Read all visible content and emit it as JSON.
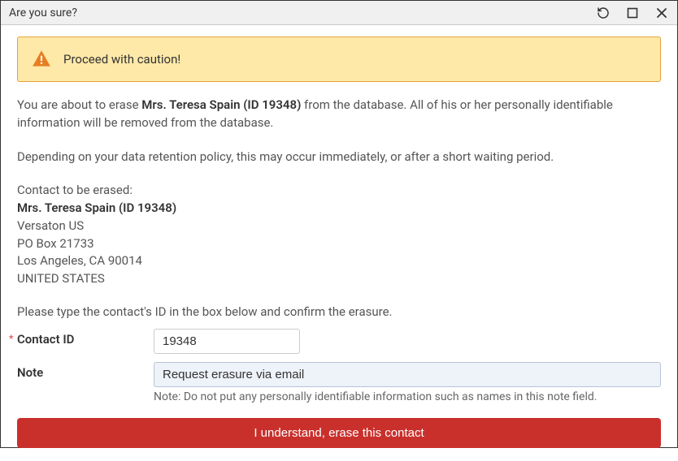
{
  "window": {
    "title": "Are you sure?"
  },
  "alert": {
    "text": "Proceed with caution!"
  },
  "body": {
    "intro_pre": "You are about to erase ",
    "intro_bold": "Mrs. Teresa Spain (ID 19348)",
    "intro_post": " from the database. All of his or her personally identifiable information will be removed from the database.",
    "retention": "Depending on your data retention policy, this may occur immediately, or after a short waiting period.",
    "contact_label": "Contact to be erased:",
    "contact_name": "Mrs. Teresa Spain (ID 19348)",
    "contact_company": "Versaton US",
    "contact_line1": "PO Box 21733",
    "contact_line2": "Los Angeles, CA 90014",
    "contact_country": "UNITED STATES",
    "instruction": "Please type the contact's ID in the box below and confirm the erasure."
  },
  "form": {
    "contact_id_label": "Contact ID",
    "contact_id_value": "19348",
    "note_label": "Note",
    "note_value": "Request erasure via email",
    "note_helper": "Note: Do not put any personally identifiable information such as names in this note field."
  },
  "button": {
    "confirm": "I understand, erase this contact"
  }
}
